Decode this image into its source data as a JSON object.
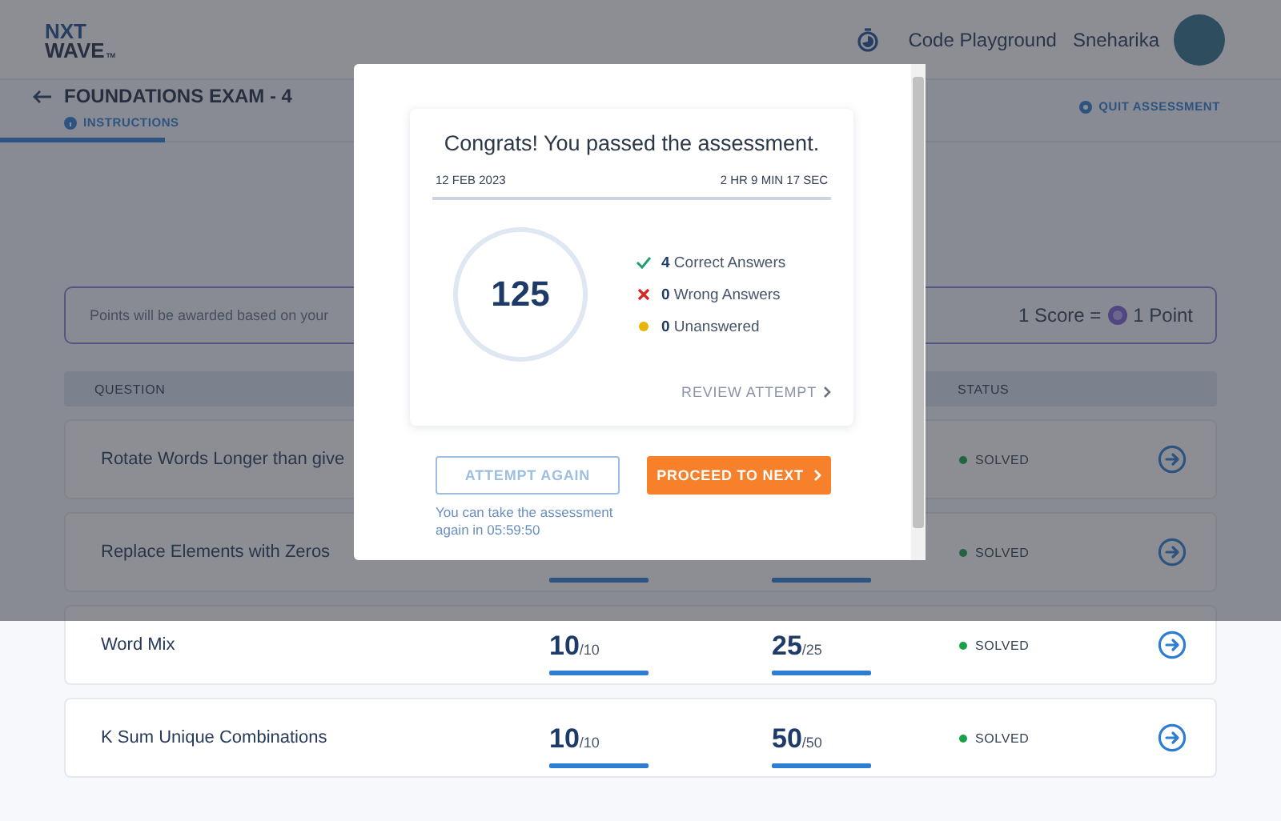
{
  "header": {
    "logo": {
      "line_1": "NXT",
      "line_2": "WAVE",
      "mark": "TM"
    },
    "link": "Code Playground",
    "user": "Sneharika"
  },
  "exam": {
    "title": "FOUNDATIONS EXAM - 4",
    "tabs": [
      {
        "label": "INSTRUCTIONS",
        "selected": true
      }
    ],
    "quit": "QUIT ASSESSMENT"
  },
  "info": {
    "text": "Points will be awarded based on your",
    "score_prefix": "1 Score =",
    "score_suffix": "1 Point"
  },
  "table": {
    "columns": [
      {
        "label": "QUESTION"
      },
      {
        "label": "STATUS"
      }
    ],
    "rows": [
      {
        "question": "Rotate Words Longer than give",
        "status": "SOLVED"
      },
      {
        "question": "Replace Elements with Zeros",
        "status": "SOLVED"
      },
      {
        "question": "Word Mix",
        "score_1": {
          "value": "10",
          "max": "/10"
        },
        "score_2": {
          "value": "25",
          "max": "/25"
        },
        "status": "SOLVED"
      },
      {
        "question": "K Sum Unique Combinations",
        "score_1": {
          "value": "10",
          "max": "/10"
        },
        "score_2": {
          "value": "50",
          "max": "/50"
        },
        "status": "SOLVED"
      }
    ]
  },
  "modal": {
    "title": "Congrats! You passed the assessment.",
    "date": "12 FEB 2023",
    "duration": "2 HR 9 MIN 17 SEC",
    "score": "125",
    "stats": [
      {
        "kind": "correct",
        "count": "4",
        "label": "Correct Answers"
      },
      {
        "kind": "wrong",
        "count": "0",
        "label": "Wrong Answers"
      },
      {
        "kind": "unanswered",
        "count": "0",
        "label": "Unanswered"
      }
    ],
    "review": "REVIEW ATTEMPT",
    "attempt_again": {
      "label": "ATTEMPT AGAIN",
      "disabled": true
    },
    "proceed": "PROCEED TO NEXT",
    "note": "You can take the assessment again in 05:59:50"
  }
}
